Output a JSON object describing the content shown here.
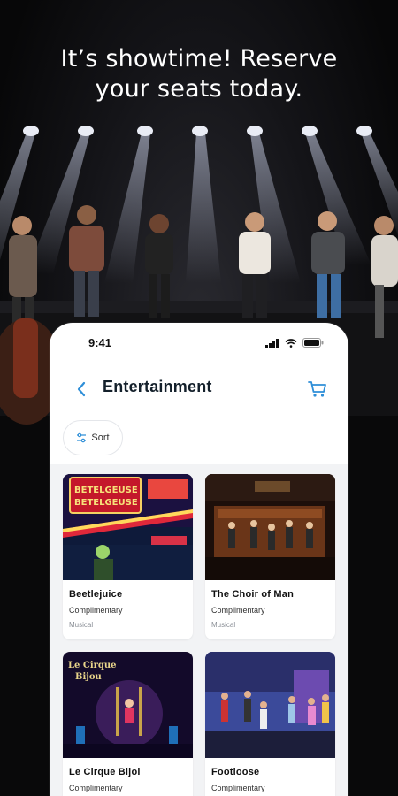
{
  "promo": {
    "headline_line1": "It’s showtime! Reserve",
    "headline_line2": "your seats today."
  },
  "status_bar": {
    "time": "9:41",
    "icons": [
      "signal-icon",
      "wifi-icon",
      "battery-icon"
    ]
  },
  "header": {
    "back_icon": "chevron-left-icon",
    "title": "Entertainment",
    "cart_icon": "cart-icon"
  },
  "toolbar": {
    "sort_icon": "sliders-icon",
    "sort_label": "Sort"
  },
  "shows": [
    {
      "name": "Beetlejuice",
      "price": "Complimentary",
      "genre": "Musical",
      "image": "beetlejuice-marquee-image"
    },
    {
      "name": "The Choir of Man",
      "price": "Complimentary",
      "genre": "Musical",
      "image": "choir-of-man-stage-image"
    },
    {
      "name": "Le Cirque Bijoi",
      "price": "Complimentary",
      "genre": "",
      "image": "le-cirque-bijou-image"
    },
    {
      "name": "Footloose",
      "price": "Complimentary",
      "genre": "",
      "image": "footloose-stage-image"
    }
  ],
  "colors": {
    "accent": "#2f8fd8",
    "title_text": "#14202b",
    "grid_background": "#f2f3f5"
  }
}
